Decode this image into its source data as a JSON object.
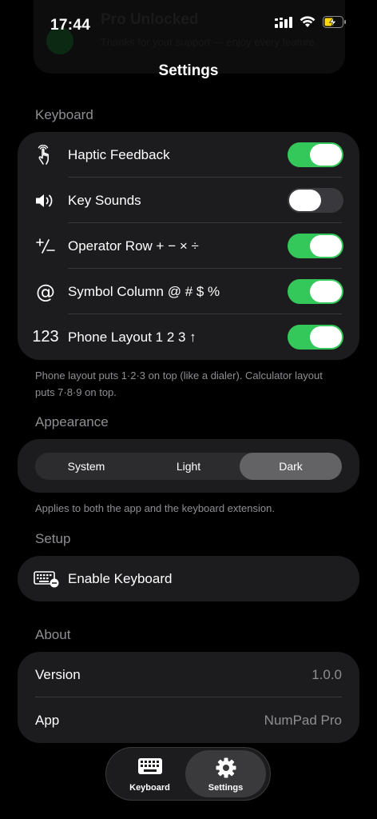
{
  "status_bar": {
    "time": "17:44"
  },
  "banner": {
    "title": "Pro Unlocked",
    "subtitle": "Thanks for your support — enjoy every feature."
  },
  "nav": {
    "title": "Settings"
  },
  "keyboard": {
    "header": "Keyboard",
    "rows": [
      {
        "label": "Haptic Feedback",
        "icon": "hand-tap-icon",
        "enabled": true
      },
      {
        "label": "Key Sounds",
        "icon": "speaker-icon",
        "enabled": false
      },
      {
        "label": "Operator Row  + − × ÷",
        "icon": "plus-minus-icon",
        "enabled": true
      },
      {
        "label": "Symbol Column  @ # $ %",
        "icon": "at-sign-icon",
        "enabled": true
      },
      {
        "label": "Phone Layout  1 2 3 ↑",
        "icon": "numbers-icon",
        "icon_text": "123",
        "enabled": true
      }
    ],
    "footnote": "Phone layout puts 1·2·3 on top (like a dialer). Calculator layout puts 7·8·9 on top."
  },
  "appearance": {
    "header": "Appearance",
    "options": [
      "System",
      "Light",
      "Dark"
    ],
    "selected": "Dark",
    "footnote": "Applies to both the app and the keyboard extension."
  },
  "setup": {
    "header": "Setup",
    "enable_keyboard_label": "Enable Keyboard"
  },
  "about": {
    "header": "About",
    "rows": [
      {
        "label": "Version",
        "value": "1.0.0"
      },
      {
        "label": "App",
        "value": "NumPad Pro"
      }
    ]
  },
  "tab_bar": {
    "tabs": [
      {
        "label": "Keyboard",
        "icon": "keyboard-icon",
        "active": false
      },
      {
        "label": "Settings",
        "icon": "gear-icon",
        "active": true
      }
    ]
  },
  "colors": {
    "accent_green": "#34c759",
    "card_bg": "#1c1c1e",
    "secondary_text": "#8e8e93"
  }
}
